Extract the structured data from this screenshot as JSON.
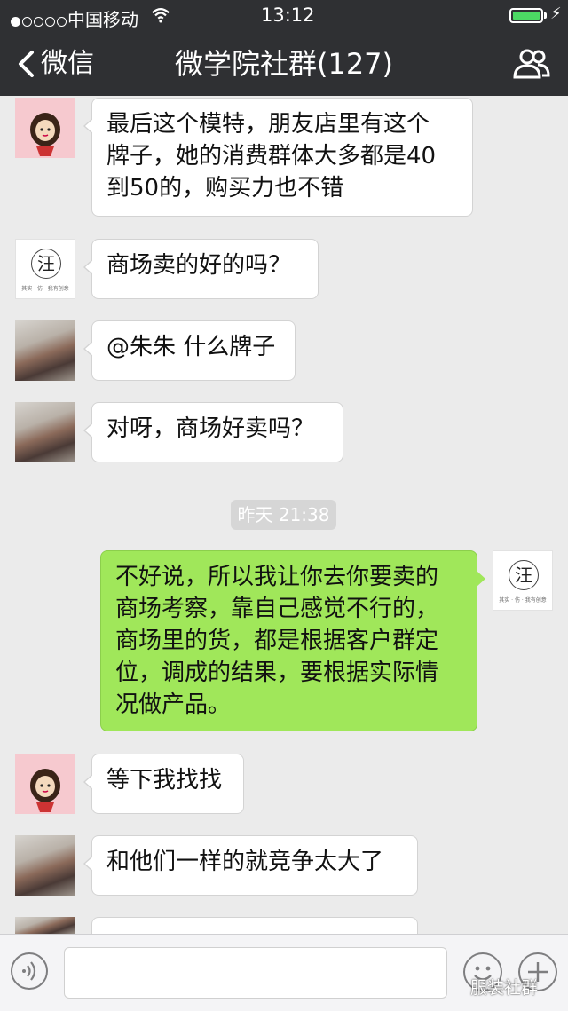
{
  "status_bar": {
    "carrier": "中国移动",
    "time": "13:12",
    "charging_symbol": "⚡"
  },
  "nav": {
    "back_label": "微信",
    "title": "微学院社群(127)",
    "icons": {
      "back": "chevron-left-icon",
      "members": "people-icon"
    }
  },
  "messages": [
    {
      "side": "in",
      "avatar": "girl-avatar",
      "text": [
        "最后这个模特，朋友店里有这个",
        "牌子，她的消费群体大多都是40",
        "到50的，购买力也不错"
      ]
    },
    {
      "side": "in",
      "avatar": "wang-avatar",
      "text": [
        "商场卖的好的吗？"
      ]
    },
    {
      "side": "in",
      "avatar": "photo-avatar",
      "text": [
        "@朱朱 什么牌子"
      ]
    },
    {
      "side": "in",
      "avatar": "photo-avatar",
      "text": [
        "对呀，商场好卖吗？"
      ]
    },
    {
      "side": "out",
      "avatar": "wang-avatar",
      "text": [
        "不好说，所以我让你去你要卖的",
        "商场考察，靠自己感觉不行的，",
        "商场里的货，都是根据客户群定",
        "位，调成的结果，要根据实际情",
        "况做产品。"
      ]
    },
    {
      "side": "in",
      "avatar": "girl-avatar",
      "text": [
        "等下我找找"
      ]
    },
    {
      "side": "in",
      "avatar": "photo-avatar",
      "text": [
        "和他们一样的就竞争太大了"
      ]
    }
  ],
  "timestamp": "昨天 21:38",
  "wang_avatar": {
    "glyph": "汪",
    "caption": "其实 · 仿 · 我有创意"
  },
  "input_bar": {
    "placeholder": "",
    "icons": {
      "voice": "voice-icon",
      "emoji": "emoji-icon",
      "more": "plus-icon"
    }
  },
  "watermark": "服装社群",
  "colors": {
    "nav_bg": "#2f3033",
    "chat_bg": "#ebebeb",
    "out_bubble": "#a0e75a",
    "in_bubble": "#ffffff"
  }
}
